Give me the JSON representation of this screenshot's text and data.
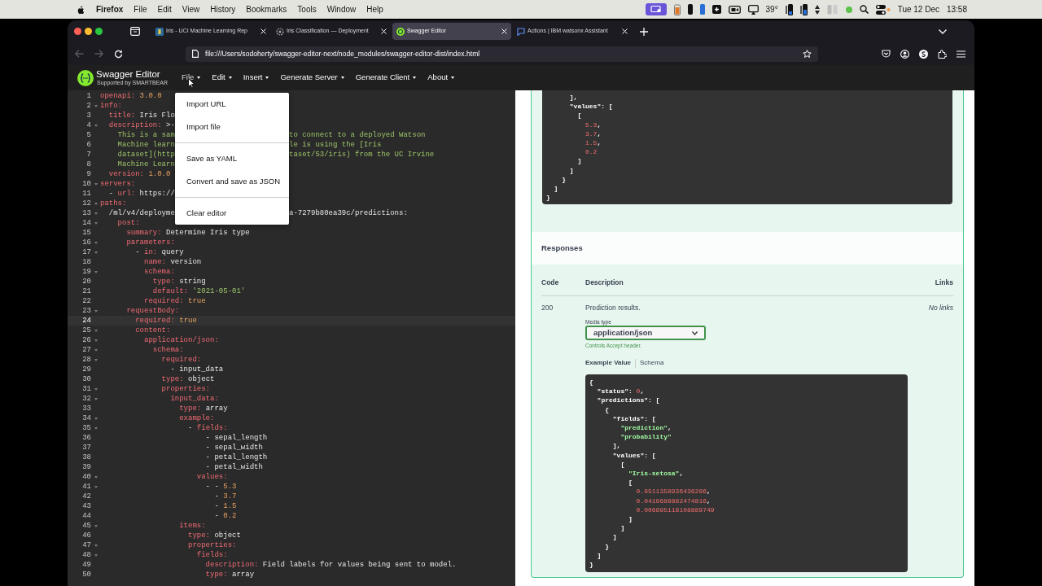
{
  "menubar": {
    "app": "Firefox",
    "menus": [
      "File",
      "Edit",
      "View",
      "History",
      "Bookmarks",
      "Tools",
      "Window",
      "Help"
    ],
    "temperature": "39°",
    "date": "Tue 12 Dec",
    "time": "13:58"
  },
  "browser": {
    "tabs": [
      {
        "title": "Iris - UCI Machine Learning Rep",
        "kind": "archive",
        "selected": false
      },
      {
        "title": "Iris Classification — Deployment",
        "kind": "watson",
        "selected": false
      },
      {
        "title": "Swagger Editor",
        "kind": "swagger",
        "selected": true
      },
      {
        "title": "Actions | IBM watsonx Assistant",
        "kind": "chat",
        "selected": false
      }
    ],
    "url": "file:///Users/sodoherty/swagger-editor-next/node_modules/swagger-editor-dist/index.html"
  },
  "swagger": {
    "title": "Swagger Editor",
    "subtitle": "Supported by SMARTBEAR",
    "menus": [
      {
        "label": "File",
        "expanded": true
      },
      {
        "label": "Edit",
        "expanded": false
      },
      {
        "label": "Insert",
        "expanded": false
      },
      {
        "label": "Generate Server",
        "expanded": false
      },
      {
        "label": "Generate Client",
        "expanded": false
      },
      {
        "label": "About",
        "expanded": false
      }
    ],
    "file_menu": [
      [
        "Import URL",
        "Import file"
      ],
      [
        "Save as YAML",
        "Convert and save as JSON"
      ],
      [
        "Clear editor"
      ]
    ]
  },
  "editor": {
    "lines": [
      {
        "n": "1",
        "fold": false,
        "current": false,
        "parts": [
          {
            "kind": "key",
            "text": "openapi:"
          },
          {
            "kind": "number",
            "text": " 3.0.0"
          }
        ]
      },
      {
        "n": "2",
        "fold": true,
        "current": false,
        "parts": [
          {
            "kind": "key",
            "text": "info:"
          }
        ]
      },
      {
        "n": "3",
        "fold": false,
        "current": false,
        "parts": [
          {
            "kind": "key",
            "text": "  title:"
          },
          {
            "kind": "plain",
            "text": " Iris Flo"
          }
        ]
      },
      {
        "n": "4",
        "fold": true,
        "current": false,
        "parts": [
          {
            "kind": "key",
            "text": "  description:"
          },
          {
            "kind": "plain",
            "text": " >-"
          }
        ]
      },
      {
        "n": "5",
        "fold": false,
        "current": false,
        "parts": [
          {
            "kind": "string",
            "text": "    This is a sam"
          }
        ],
        "tail": [
          {
            "kind": "string",
            "text": "to connect to a deployed Watson"
          }
        ]
      },
      {
        "n": "6",
        "fold": false,
        "current": false,
        "parts": [
          {
            "kind": "string",
            "text": "    Machine learn"
          }
        ],
        "tail": [
          {
            "kind": "string",
            "text": "le is using the [Iris"
          }
        ]
      },
      {
        "n": "7",
        "fold": false,
        "current": false,
        "parts": [
          {
            "kind": "string",
            "text": "    dataset](http"
          }
        ],
        "tail": [
          {
            "kind": "string",
            "text": "taset/53/iris) from the UC Irvine"
          }
        ]
      },
      {
        "n": "8",
        "fold": false,
        "current": false,
        "parts": [
          {
            "kind": "string",
            "text": "    Machine Learn"
          }
        ]
      },
      {
        "n": "9",
        "fold": false,
        "current": false,
        "parts": [
          {
            "kind": "key",
            "text": "  version:"
          },
          {
            "kind": "number",
            "text": " 1.0.0"
          }
        ]
      },
      {
        "n": "10",
        "fold": true,
        "current": false,
        "parts": [
          {
            "kind": "key",
            "text": "servers:"
          }
        ]
      },
      {
        "n": "11",
        "fold": false,
        "current": false,
        "parts": [
          {
            "kind": "plain",
            "text": "  - "
          },
          {
            "kind": "key",
            "text": "url:"
          },
          {
            "kind": "plain",
            "text": " https://"
          }
        ]
      },
      {
        "n": "12",
        "fold": true,
        "current": false,
        "parts": [
          {
            "kind": "key",
            "text": "paths:"
          }
        ]
      },
      {
        "n": "13",
        "fold": true,
        "current": false,
        "parts": [
          {
            "kind": "plain",
            "text": "  /ml/v4/deployme"
          }
        ],
        "tail": [
          {
            "kind": "plain",
            "text": "a-7279b80ea39c/predictions:"
          }
        ]
      },
      {
        "n": "14",
        "fold": true,
        "current": false,
        "parts": [
          {
            "kind": "key",
            "text": "    post:"
          }
        ]
      },
      {
        "n": "15",
        "fold": false,
        "current": false,
        "parts": [
          {
            "kind": "key",
            "text": "      summary:"
          },
          {
            "kind": "plain",
            "text": " Determine Iris type"
          }
        ]
      },
      {
        "n": "16",
        "fold": true,
        "current": false,
        "parts": [
          {
            "kind": "key",
            "text": "      parameters:"
          }
        ]
      },
      {
        "n": "17",
        "fold": true,
        "current": false,
        "parts": [
          {
            "kind": "plain",
            "text": "        - "
          },
          {
            "kind": "key",
            "text": "in:"
          },
          {
            "kind": "plain",
            "text": " query"
          }
        ]
      },
      {
        "n": "18",
        "fold": false,
        "current": false,
        "parts": [
          {
            "kind": "key",
            "text": "          name:"
          },
          {
            "kind": "plain",
            "text": " version"
          }
        ]
      },
      {
        "n": "19",
        "fold": true,
        "current": false,
        "parts": [
          {
            "kind": "key",
            "text": "          schema:"
          }
        ]
      },
      {
        "n": "20",
        "fold": false,
        "current": false,
        "parts": [
          {
            "kind": "key",
            "text": "            type:"
          },
          {
            "kind": "plain",
            "text": " string"
          }
        ]
      },
      {
        "n": "21",
        "fold": false,
        "current": false,
        "parts": [
          {
            "kind": "key",
            "text": "            default:"
          },
          {
            "kind": "string",
            "text": " '2021-05-01'"
          }
        ]
      },
      {
        "n": "22",
        "fold": false,
        "current": false,
        "parts": [
          {
            "kind": "key",
            "text": "          required:"
          },
          {
            "kind": "number",
            "text": " true"
          }
        ]
      },
      {
        "n": "23",
        "fold": true,
        "current": false,
        "parts": [
          {
            "kind": "key",
            "text": "      requestBody:"
          }
        ]
      },
      {
        "n": "24",
        "fold": false,
        "current": true,
        "parts": [
          {
            "kind": "key",
            "text": "        required:"
          },
          {
            "kind": "number",
            "text": " true"
          }
        ]
      },
      {
        "n": "25",
        "fold": true,
        "current": false,
        "parts": [
          {
            "kind": "key",
            "text": "        content:"
          }
        ]
      },
      {
        "n": "26",
        "fold": true,
        "current": false,
        "parts": [
          {
            "kind": "key",
            "text": "          application/json:"
          }
        ]
      },
      {
        "n": "27",
        "fold": true,
        "current": false,
        "parts": [
          {
            "kind": "key",
            "text": "            schema:"
          }
        ]
      },
      {
        "n": "28",
        "fold": true,
        "current": false,
        "parts": [
          {
            "kind": "key",
            "text": "              required:"
          }
        ]
      },
      {
        "n": "29",
        "fold": false,
        "current": false,
        "parts": [
          {
            "kind": "plain",
            "text": "                - input_data"
          }
        ]
      },
      {
        "n": "30",
        "fold": false,
        "current": false,
        "parts": [
          {
            "kind": "key",
            "text": "              type:"
          },
          {
            "kind": "plain",
            "text": " object"
          }
        ]
      },
      {
        "n": "31",
        "fold": true,
        "current": false,
        "parts": [
          {
            "kind": "key",
            "text": "              properties:"
          }
        ]
      },
      {
        "n": "32",
        "fold": true,
        "current": false,
        "parts": [
          {
            "kind": "key",
            "text": "                input_data:"
          }
        ]
      },
      {
        "n": "33",
        "fold": false,
        "current": false,
        "parts": [
          {
            "kind": "key",
            "text": "                  type:"
          },
          {
            "kind": "plain",
            "text": " array"
          }
        ]
      },
      {
        "n": "34",
        "fold": true,
        "current": false,
        "parts": [
          {
            "kind": "key",
            "text": "                  example:"
          }
        ]
      },
      {
        "n": "35",
        "fold": true,
        "current": false,
        "parts": [
          {
            "kind": "plain",
            "text": "                    - "
          },
          {
            "kind": "key",
            "text": "fields:"
          }
        ]
      },
      {
        "n": "36",
        "fold": false,
        "current": false,
        "parts": [
          {
            "kind": "plain",
            "text": "                        - sepal_length"
          }
        ]
      },
      {
        "n": "37",
        "fold": false,
        "current": false,
        "parts": [
          {
            "kind": "plain",
            "text": "                        - sepal_width"
          }
        ]
      },
      {
        "n": "38",
        "fold": false,
        "current": false,
        "parts": [
          {
            "kind": "plain",
            "text": "                        - petal_length"
          }
        ]
      },
      {
        "n": "39",
        "fold": false,
        "current": false,
        "parts": [
          {
            "kind": "plain",
            "text": "                        - petal_width"
          }
        ]
      },
      {
        "n": "40",
        "fold": true,
        "current": false,
        "parts": [
          {
            "kind": "key",
            "text": "                      values:"
          }
        ]
      },
      {
        "n": "41",
        "fold": true,
        "current": false,
        "parts": [
          {
            "kind": "plain",
            "text": "                        - - "
          },
          {
            "kind": "number",
            "text": "5.3"
          }
        ]
      },
      {
        "n": "42",
        "fold": false,
        "current": false,
        "parts": [
          {
            "kind": "plain",
            "text": "                          - "
          },
          {
            "kind": "number",
            "text": "3.7"
          }
        ]
      },
      {
        "n": "43",
        "fold": false,
        "current": false,
        "parts": [
          {
            "kind": "plain",
            "text": "                          - "
          },
          {
            "kind": "number",
            "text": "1.5"
          }
        ]
      },
      {
        "n": "44",
        "fold": false,
        "current": false,
        "parts": [
          {
            "kind": "plain",
            "text": "                          - "
          },
          {
            "kind": "number",
            "text": "0.2"
          }
        ]
      },
      {
        "n": "45",
        "fold": true,
        "current": false,
        "parts": [
          {
            "kind": "key",
            "text": "                  items:"
          }
        ]
      },
      {
        "n": "46",
        "fold": false,
        "current": false,
        "parts": [
          {
            "kind": "key",
            "text": "                    type:"
          },
          {
            "kind": "plain",
            "text": " object"
          }
        ]
      },
      {
        "n": "47",
        "fold": true,
        "current": false,
        "parts": [
          {
            "kind": "key",
            "text": "                    properties:"
          }
        ]
      },
      {
        "n": "48",
        "fold": true,
        "current": false,
        "parts": [
          {
            "kind": "key",
            "text": "                      fields:"
          }
        ]
      },
      {
        "n": "49",
        "fold": false,
        "current": false,
        "parts": [
          {
            "kind": "key",
            "text": "                        description:"
          },
          {
            "kind": "plain",
            "text": " Field labels for values being sent to model."
          }
        ]
      },
      {
        "n": "50",
        "fold": false,
        "current": false,
        "parts": [
          {
            "kind": "key",
            "text": "                        type:"
          },
          {
            "kind": "plain",
            "text": " array"
          }
        ]
      }
    ]
  },
  "preview": {
    "request_example": {
      "lines": [
        [
          {
            "kind": "plain",
            "text": "      ],"
          }
        ],
        [
          {
            "kind": "plain",
            "text": "      \"values\": ["
          }
        ],
        [
          {
            "kind": "plain",
            "text": "        ["
          }
        ],
        [
          {
            "kind": "number",
            "text": "          5.3"
          },
          {
            "kind": "plain",
            "text": ","
          }
        ],
        [
          {
            "kind": "number",
            "text": "          3.7"
          },
          {
            "kind": "plain",
            "text": ","
          }
        ],
        [
          {
            "kind": "number",
            "text": "          1.5"
          },
          {
            "kind": "plain",
            "text": ","
          }
        ],
        [
          {
            "kind": "number",
            "text": "          0.2"
          }
        ],
        [
          {
            "kind": "plain",
            "text": "        ]"
          }
        ],
        [
          {
            "kind": "plain",
            "text": "      ]"
          }
        ],
        [
          {
            "kind": "plain",
            "text": "    }"
          }
        ],
        [
          {
            "kind": "plain",
            "text": "  ]"
          }
        ],
        [
          {
            "kind": "plain",
            "text": "}"
          }
        ]
      ]
    },
    "responses": {
      "title": "Responses",
      "columns": [
        "Code",
        "Description",
        "Links"
      ],
      "rows": [
        {
          "code": "200",
          "description": "Prediction results.",
          "links": "No links",
          "media_type_label": "Media type",
          "media_type": "application/json",
          "media_type_hint": "Controls Accept header.",
          "example_tabs": [
            {
              "label": "Example Value",
              "selected": true
            },
            {
              "label": "Schema",
              "selected": false
            }
          ],
          "example": [
            [
              {
                "kind": "plain",
                "text": "{"
              }
            ],
            [
              {
                "kind": "plain",
                "text": "  \"status\": "
              },
              {
                "kind": "number",
                "text": "0"
              },
              {
                "kind": "plain",
                "text": ","
              }
            ],
            [
              {
                "kind": "plain",
                "text": "  \"predictions\": ["
              }
            ],
            [
              {
                "kind": "plain",
                "text": "    {"
              }
            ],
            [
              {
                "kind": "plain",
                "text": "      \"fields\": ["
              }
            ],
            [
              {
                "kind": "string",
                "text": "        \"prediction\""
              },
              {
                "kind": "plain",
                "text": ","
              }
            ],
            [
              {
                "kind": "string",
                "text": "        \"probability\""
              }
            ],
            [
              {
                "kind": "plain",
                "text": "      ],"
              }
            ],
            [
              {
                "kind": "plain",
                "text": "      \"values\": ["
              }
            ],
            [
              {
                "kind": "plain",
                "text": "        ["
              }
            ],
            [
              {
                "kind": "string",
                "text": "          \"Iris-setosa\""
              },
              {
                "kind": "plain",
                "text": ","
              }
            ],
            [
              {
                "kind": "plain",
                "text": "          ["
              }
            ],
            [
              {
                "kind": "number",
                "text": "            0.9511358936436286"
              },
              {
                "kind": "plain",
                "text": ","
              }
            ],
            [
              {
                "kind": "number",
                "text": "            0.0419689882474816"
              },
              {
                "kind": "plain",
                "text": ","
              }
            ],
            [
              {
                "kind": "number",
                "text": "            0.006895118108889749"
              }
            ],
            [
              {
                "kind": "plain",
                "text": "          ]"
              }
            ],
            [
              {
                "kind": "plain",
                "text": "        ]"
              }
            ],
            [
              {
                "kind": "plain",
                "text": "      ]"
              }
            ],
            [
              {
                "kind": "plain",
                "text": "    }"
              }
            ],
            [
              {
                "kind": "plain",
                "text": "  ]"
              }
            ],
            [
              {
                "kind": "plain",
                "text": "}"
              }
            ]
          ]
        }
      ]
    }
  }
}
